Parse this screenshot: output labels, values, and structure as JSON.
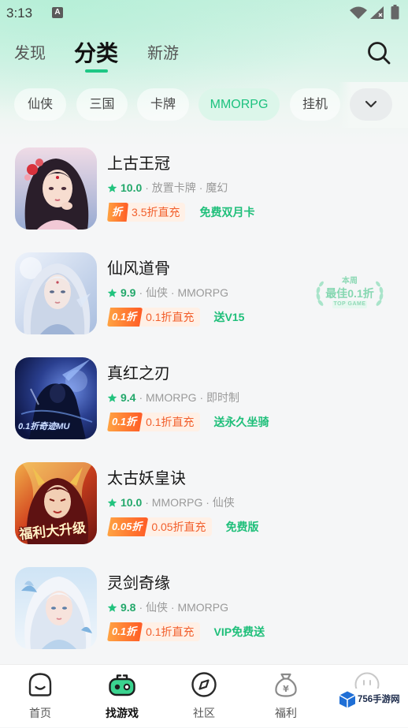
{
  "status_bar": {
    "time": "3:13",
    "notification_glyph": "A",
    "icons": [
      "notification-a-icon",
      "wifi-icon",
      "signal-icon",
      "battery-icon"
    ]
  },
  "header": {
    "tabs": [
      {
        "label": "发现",
        "active": false
      },
      {
        "label": "分类",
        "active": true
      },
      {
        "label": "新游",
        "active": false
      }
    ],
    "search_icon": "search-icon"
  },
  "categories": {
    "items": [
      {
        "label": "仙侠",
        "active": false
      },
      {
        "label": "三国",
        "active": false
      },
      {
        "label": "卡牌",
        "active": false
      },
      {
        "label": "MMORPG",
        "active": true
      },
      {
        "label": "挂机",
        "active": false
      }
    ],
    "expand_icon": "chevron-down-icon"
  },
  "games": [
    {
      "title": "上古王冠",
      "rating": "10.0",
      "meta": "· 放置卡牌 · 魔幻",
      "discount_badge": "折",
      "discount_text": "3.5折直充",
      "perk": "免费双月卡"
    },
    {
      "title": "仙风道骨",
      "rating": "9.9",
      "meta": "· 仙侠 · MMORPG",
      "discount_badge": "0.1折",
      "discount_text": "0.1折直充",
      "perk": "送V15",
      "featured": {
        "line1": "本周",
        "line2": "最佳0.1折",
        "line3": "TOP GAME"
      }
    },
    {
      "title": "真红之刃",
      "rating": "9.4",
      "meta": "· MMORPG · 即时制",
      "discount_badge": "0.1折",
      "discount_text": "0.1折直充",
      "perk": "送永久坐骑",
      "art_text": "0.1折奇迹MU"
    },
    {
      "title": "太古妖皇诀",
      "rating": "10.0",
      "meta": "· MMORPG · 仙侠",
      "discount_badge": "0.05折",
      "discount_text": "0.05折直充",
      "perk": "免费版",
      "art_text": "福利大升级"
    },
    {
      "title": "灵剑奇缘",
      "rating": "9.8",
      "meta": "· 仙侠 · MMORPG",
      "discount_badge": "0.1折",
      "discount_text": "0.1折直充",
      "perk": "VIP免费送"
    }
  ],
  "bottom_nav": [
    {
      "label": "首页",
      "icon": "home-icon",
      "active": false
    },
    {
      "label": "找游戏",
      "icon": "gamepad-icon",
      "active": true
    },
    {
      "label": "社区",
      "icon": "compass-icon",
      "active": false
    },
    {
      "label": "福利",
      "icon": "money-bag-icon",
      "icon_glyph": "¥",
      "active": false
    },
    {
      "icon": "circle-icon",
      "active": false
    }
  ],
  "watermark": {
    "text": "756手游网",
    "icon": "cube-logo-icon"
  },
  "colors": {
    "accent_green": "#1ec785",
    "rating_green": "#23a86b",
    "perk_green": "#1fbf7a",
    "discount_orange": "#f25f2c",
    "background": "#f5f6f7"
  }
}
